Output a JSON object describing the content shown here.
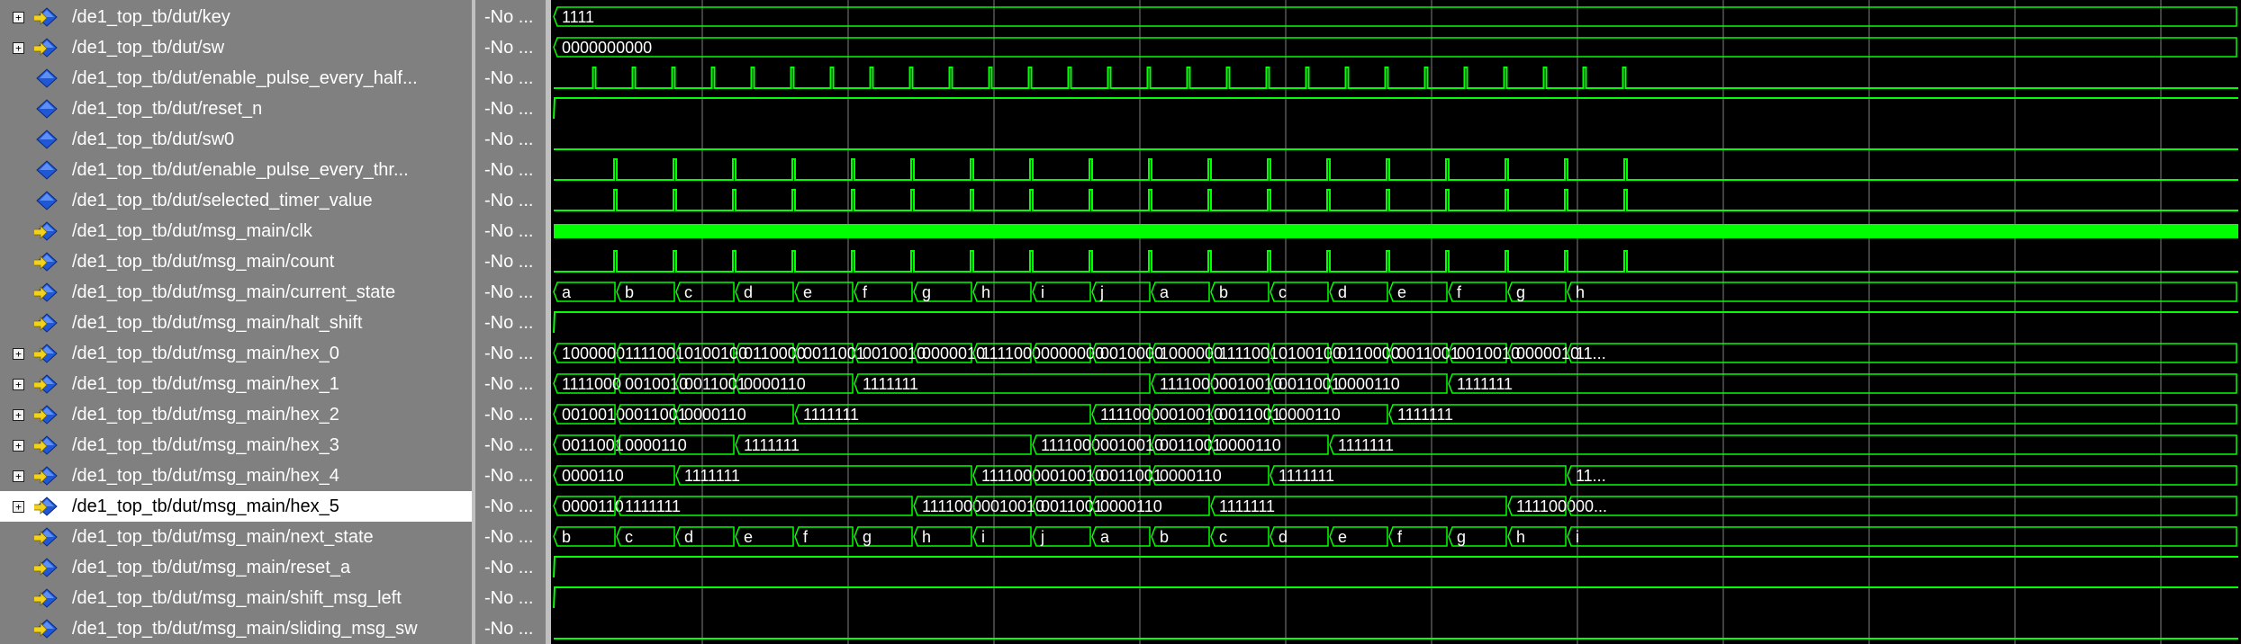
{
  "panes": {
    "value_header_text": "-No ..."
  },
  "colors": {
    "background": "#000000",
    "wave": "#00ff00",
    "grid": "#808080",
    "panel": "#808080",
    "selected": "#ffffff"
  },
  "signals": [
    {
      "name": "/de1_top_tb/dut/key",
      "value": "-No ...",
      "expandable": true,
      "icon": "bus-in-arrow-icon",
      "wave": {
        "type": "bus",
        "segments": [
          [
            0,
            "1111"
          ]
        ]
      }
    },
    {
      "name": "/de1_top_tb/dut/sw",
      "value": "-No ...",
      "expandable": true,
      "icon": "bus-in-arrow-icon",
      "wave": {
        "type": "bus",
        "segments": [
          [
            0,
            "0000000000"
          ]
        ]
      }
    },
    {
      "name": "/de1_top_tb/dut/enable_pulse_every_half...",
      "value": "-No ...",
      "expandable": false,
      "icon": "diamond-icon",
      "wave": {
        "type": "pulses",
        "start": 46.5,
        "period": 44,
        "count": 27,
        "width": 3
      }
    },
    {
      "name": "/de1_top_tb/dut/reset_n",
      "value": "-No ...",
      "expandable": false,
      "icon": "diamond-icon",
      "wave": {
        "type": "step",
        "level": "high",
        "at": 3
      }
    },
    {
      "name": "/de1_top_tb/dut/sw0",
      "value": "-No ...",
      "expandable": false,
      "icon": "diamond-icon",
      "wave": {
        "type": "const",
        "level": "low"
      }
    },
    {
      "name": "/de1_top_tb/dut/enable_pulse_every_thr...",
      "value": "-No ...",
      "expandable": false,
      "icon": "diamond-icon",
      "wave": {
        "type": "pulses",
        "start": 70,
        "period": 66,
        "count": 18,
        "width": 3
      }
    },
    {
      "name": "/de1_top_tb/dut/selected_timer_value",
      "value": "-No ...",
      "expandable": false,
      "icon": "diamond-icon",
      "wave": {
        "type": "pulses",
        "start": 70,
        "period": 66,
        "count": 18,
        "width": 3
      }
    },
    {
      "name": "/de1_top_tb/dut/msg_main/clk",
      "value": "-No ...",
      "expandable": false,
      "icon": "arrow-diamond-icon",
      "wave": {
        "type": "dense"
      }
    },
    {
      "name": "/de1_top_tb/dut/msg_main/count",
      "value": "-No ...",
      "expandable": false,
      "icon": "arrow-diamond-icon",
      "wave": {
        "type": "pulses",
        "start": 70,
        "period": 66,
        "count": 18,
        "width": 3
      }
    },
    {
      "name": "/de1_top_tb/dut/msg_main/current_state",
      "value": "-No ...",
      "expandable": false,
      "icon": "arrow-diamond-icon",
      "wave": {
        "type": "bus",
        "segments": [
          [
            0,
            "a"
          ],
          [
            70,
            "b"
          ],
          [
            136,
            "c"
          ],
          [
            202,
            "d"
          ],
          [
            268,
            "e"
          ],
          [
            334,
            "f"
          ],
          [
            400,
            "g"
          ],
          [
            466,
            "h"
          ],
          [
            532,
            "i"
          ],
          [
            598,
            "j"
          ],
          [
            664,
            "a"
          ],
          [
            730,
            "b"
          ],
          [
            796,
            "c"
          ],
          [
            862,
            "d"
          ],
          [
            928,
            "e"
          ],
          [
            994,
            "f"
          ],
          [
            1060,
            "g"
          ],
          [
            1126,
            "h"
          ]
        ]
      }
    },
    {
      "name": "/de1_top_tb/dut/msg_main/halt_shift",
      "value": "-No ...",
      "expandable": false,
      "icon": "arrow-diamond-icon",
      "wave": {
        "type": "step",
        "level": "high",
        "at": 3
      }
    },
    {
      "name": "/de1_top_tb/dut/msg_main/hex_0",
      "value": "-No ...",
      "expandable": true,
      "icon": "bus-arrow-icon",
      "wave": {
        "type": "bus",
        "segments": [
          [
            0,
            "1000000"
          ],
          [
            70,
            "1111001"
          ],
          [
            136,
            "0100100"
          ],
          [
            202,
            "0110000"
          ],
          [
            268,
            "0011001"
          ],
          [
            334,
            "0010010"
          ],
          [
            400,
            "0000010"
          ],
          [
            466,
            "1111000"
          ],
          [
            532,
            "0000000"
          ],
          [
            598,
            "0010000"
          ],
          [
            664,
            "1000000"
          ],
          [
            730,
            "1111001"
          ],
          [
            796,
            "0100100"
          ],
          [
            862,
            "0110000"
          ],
          [
            928,
            "0011001"
          ],
          [
            994,
            "0010010"
          ],
          [
            1060,
            "0000010"
          ],
          [
            1126,
            "11..."
          ]
        ]
      }
    },
    {
      "name": "/de1_top_tb/dut/msg_main/hex_1",
      "value": "-No ...",
      "expandable": true,
      "icon": "bus-arrow-icon",
      "wave": {
        "type": "bus",
        "segments": [
          [
            0,
            "1111000"
          ],
          [
            70,
            "0010010"
          ],
          [
            136,
            "0011001"
          ],
          [
            202,
            "0000110"
          ],
          [
            334,
            "1111111"
          ],
          [
            664,
            "1111000"
          ],
          [
            730,
            "0010010"
          ],
          [
            796,
            "0011001"
          ],
          [
            862,
            "0000110"
          ],
          [
            994,
            "1111111"
          ]
        ]
      }
    },
    {
      "name": "/de1_top_tb/dut/msg_main/hex_2",
      "value": "-No ...",
      "expandable": true,
      "icon": "bus-arrow-icon",
      "wave": {
        "type": "bus",
        "segments": [
          [
            0,
            "0010010"
          ],
          [
            70,
            "0011001"
          ],
          [
            136,
            "0000110"
          ],
          [
            268,
            "1111111"
          ],
          [
            598,
            "1111000"
          ],
          [
            664,
            "0010010"
          ],
          [
            730,
            "0011001"
          ],
          [
            796,
            "0000110"
          ],
          [
            928,
            "1111111"
          ]
        ]
      }
    },
    {
      "name": "/de1_top_tb/dut/msg_main/hex_3",
      "value": "-No ...",
      "expandable": true,
      "icon": "bus-arrow-icon",
      "wave": {
        "type": "bus",
        "segments": [
          [
            0,
            "0011001"
          ],
          [
            70,
            "0000110"
          ],
          [
            202,
            "1111111"
          ],
          [
            532,
            "1111000"
          ],
          [
            598,
            "0010010"
          ],
          [
            664,
            "0011001"
          ],
          [
            730,
            "0000110"
          ],
          [
            862,
            "1111111"
          ]
        ]
      }
    },
    {
      "name": "/de1_top_tb/dut/msg_main/hex_4",
      "value": "-No ...",
      "expandable": true,
      "icon": "bus-arrow-icon",
      "wave": {
        "type": "bus",
        "segments": [
          [
            0,
            "0000110"
          ],
          [
            136,
            "1111111"
          ],
          [
            466,
            "1111000"
          ],
          [
            532,
            "0010010"
          ],
          [
            598,
            "0011001"
          ],
          [
            664,
            "0000110"
          ],
          [
            796,
            "1111111"
          ],
          [
            1126,
            "11..."
          ]
        ]
      }
    },
    {
      "name": "/de1_top_tb/dut/msg_main/hex_5",
      "value": "-No ...",
      "expandable": true,
      "icon": "bus-arrow-icon",
      "selected": true,
      "wave": {
        "type": "bus",
        "segments": [
          [
            0,
            "0000110"
          ],
          [
            70,
            "1111111"
          ],
          [
            400,
            "1111000"
          ],
          [
            466,
            "0010010"
          ],
          [
            532,
            "0011001"
          ],
          [
            598,
            "0000110"
          ],
          [
            730,
            "1111111"
          ],
          [
            1060,
            "1111000"
          ],
          [
            1126,
            "00..."
          ]
        ]
      }
    },
    {
      "name": "/de1_top_tb/dut/msg_main/next_state",
      "value": "-No ...",
      "expandable": false,
      "icon": "arrow-diamond-icon",
      "wave": {
        "type": "bus",
        "segments": [
          [
            0,
            "b"
          ],
          [
            70,
            "c"
          ],
          [
            136,
            "d"
          ],
          [
            202,
            "e"
          ],
          [
            268,
            "f"
          ],
          [
            334,
            "g"
          ],
          [
            400,
            "h"
          ],
          [
            466,
            "i"
          ],
          [
            532,
            "j"
          ],
          [
            598,
            "a"
          ],
          [
            664,
            "b"
          ],
          [
            730,
            "c"
          ],
          [
            796,
            "d"
          ],
          [
            862,
            "e"
          ],
          [
            928,
            "f"
          ],
          [
            994,
            "g"
          ],
          [
            1060,
            "h"
          ],
          [
            1126,
            "i"
          ]
        ]
      }
    },
    {
      "name": "/de1_top_tb/dut/msg_main/reset_a",
      "value": "-No ...",
      "expandable": false,
      "icon": "arrow-diamond-icon",
      "wave": {
        "type": "step",
        "level": "high",
        "at": 3
      }
    },
    {
      "name": "/de1_top_tb/dut/msg_main/shift_msg_left",
      "value": "-No ...",
      "expandable": false,
      "icon": "arrow-diamond-icon",
      "wave": {
        "type": "step",
        "level": "high",
        "at": 3
      }
    },
    {
      "name": "/de1_top_tb/dut/msg_main/sliding_msg_sw",
      "value": "-No ...",
      "expandable": false,
      "icon": "arrow-diamond-icon",
      "wave": {
        "type": "const",
        "level": "low"
      }
    }
  ]
}
